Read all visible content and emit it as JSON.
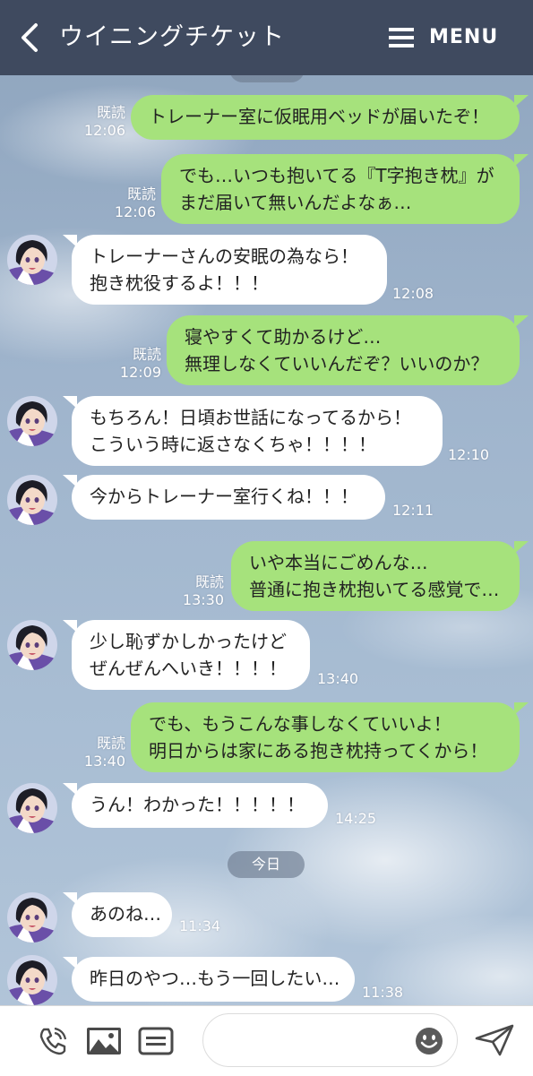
{
  "header": {
    "title": "ウイニングチケット",
    "menu_label": "MENU"
  },
  "date_chips": {
    "top": "今日",
    "today": "今日"
  },
  "labels": {
    "read": "既読"
  },
  "messages": [
    {
      "side": "out",
      "lines": [
        "トレーナー室に仮眠用ベッドが届いたぞ！"
      ],
      "read": "既読",
      "time": "12:06"
    },
    {
      "side": "out",
      "lines": [
        "でも…いつも抱いてる『T字抱き枕』が",
        "まだ届いて無いんだよなぁ…"
      ],
      "read": "既読",
      "time": "12:06"
    },
    {
      "side": "in",
      "lines": [
        "トレーナーさんの安眠の為なら！",
        "抱き枕役するよ！！！"
      ],
      "time": "12:08"
    },
    {
      "side": "out",
      "lines": [
        "寝やすくて助かるけど…",
        "無理しなくていいんだぞ？いいのか？"
      ],
      "read": "既読",
      "time": "12:09"
    },
    {
      "side": "in",
      "lines": [
        "もちろん！日頃お世話になってるから！",
        "こういう時に返さなくちゃ！！！！"
      ],
      "time": "12:10"
    },
    {
      "side": "in",
      "lines": [
        "今からトレーナー室行くね！！！"
      ],
      "time": "12:11"
    },
    {
      "side": "out",
      "lines": [
        "いや本当にごめんな…",
        "普通に抱き枕抱いてる感覚で…"
      ],
      "read": "既読",
      "time": "13:30"
    },
    {
      "side": "in",
      "lines": [
        "少し恥ずかしかったけど",
        "ぜんぜんへいき！！！！"
      ],
      "time": "13:40"
    },
    {
      "side": "out",
      "lines": [
        "でも、もうこんな事しなくていいよ！",
        "明日からは家にある抱き枕持ってくから！"
      ],
      "read": "既読",
      "time": "13:40"
    },
    {
      "side": "in",
      "lines": [
        "うん！わかった！！！！！"
      ],
      "time": "14:25"
    },
    {
      "side": "in",
      "lines": [
        "あのね…"
      ],
      "time": "11:34"
    },
    {
      "side": "in",
      "lines": [
        "昨日のやつ…もう一回したい…"
      ],
      "time": "11:38"
    }
  ],
  "input": {
    "placeholder": ""
  },
  "icons": {
    "back": "chevron-left-icon",
    "menu": "hamburger-icon",
    "call": "phone-icon",
    "image": "image-icon",
    "card": "card-icon",
    "emoji": "smiley-icon",
    "send": "send-icon"
  },
  "colors": {
    "header_bg": "#3f4a5f",
    "outgoing_bubble": "#a6e27c",
    "incoming_bubble": "#ffffff",
    "chat_bg": "#9fb4cc"
  }
}
